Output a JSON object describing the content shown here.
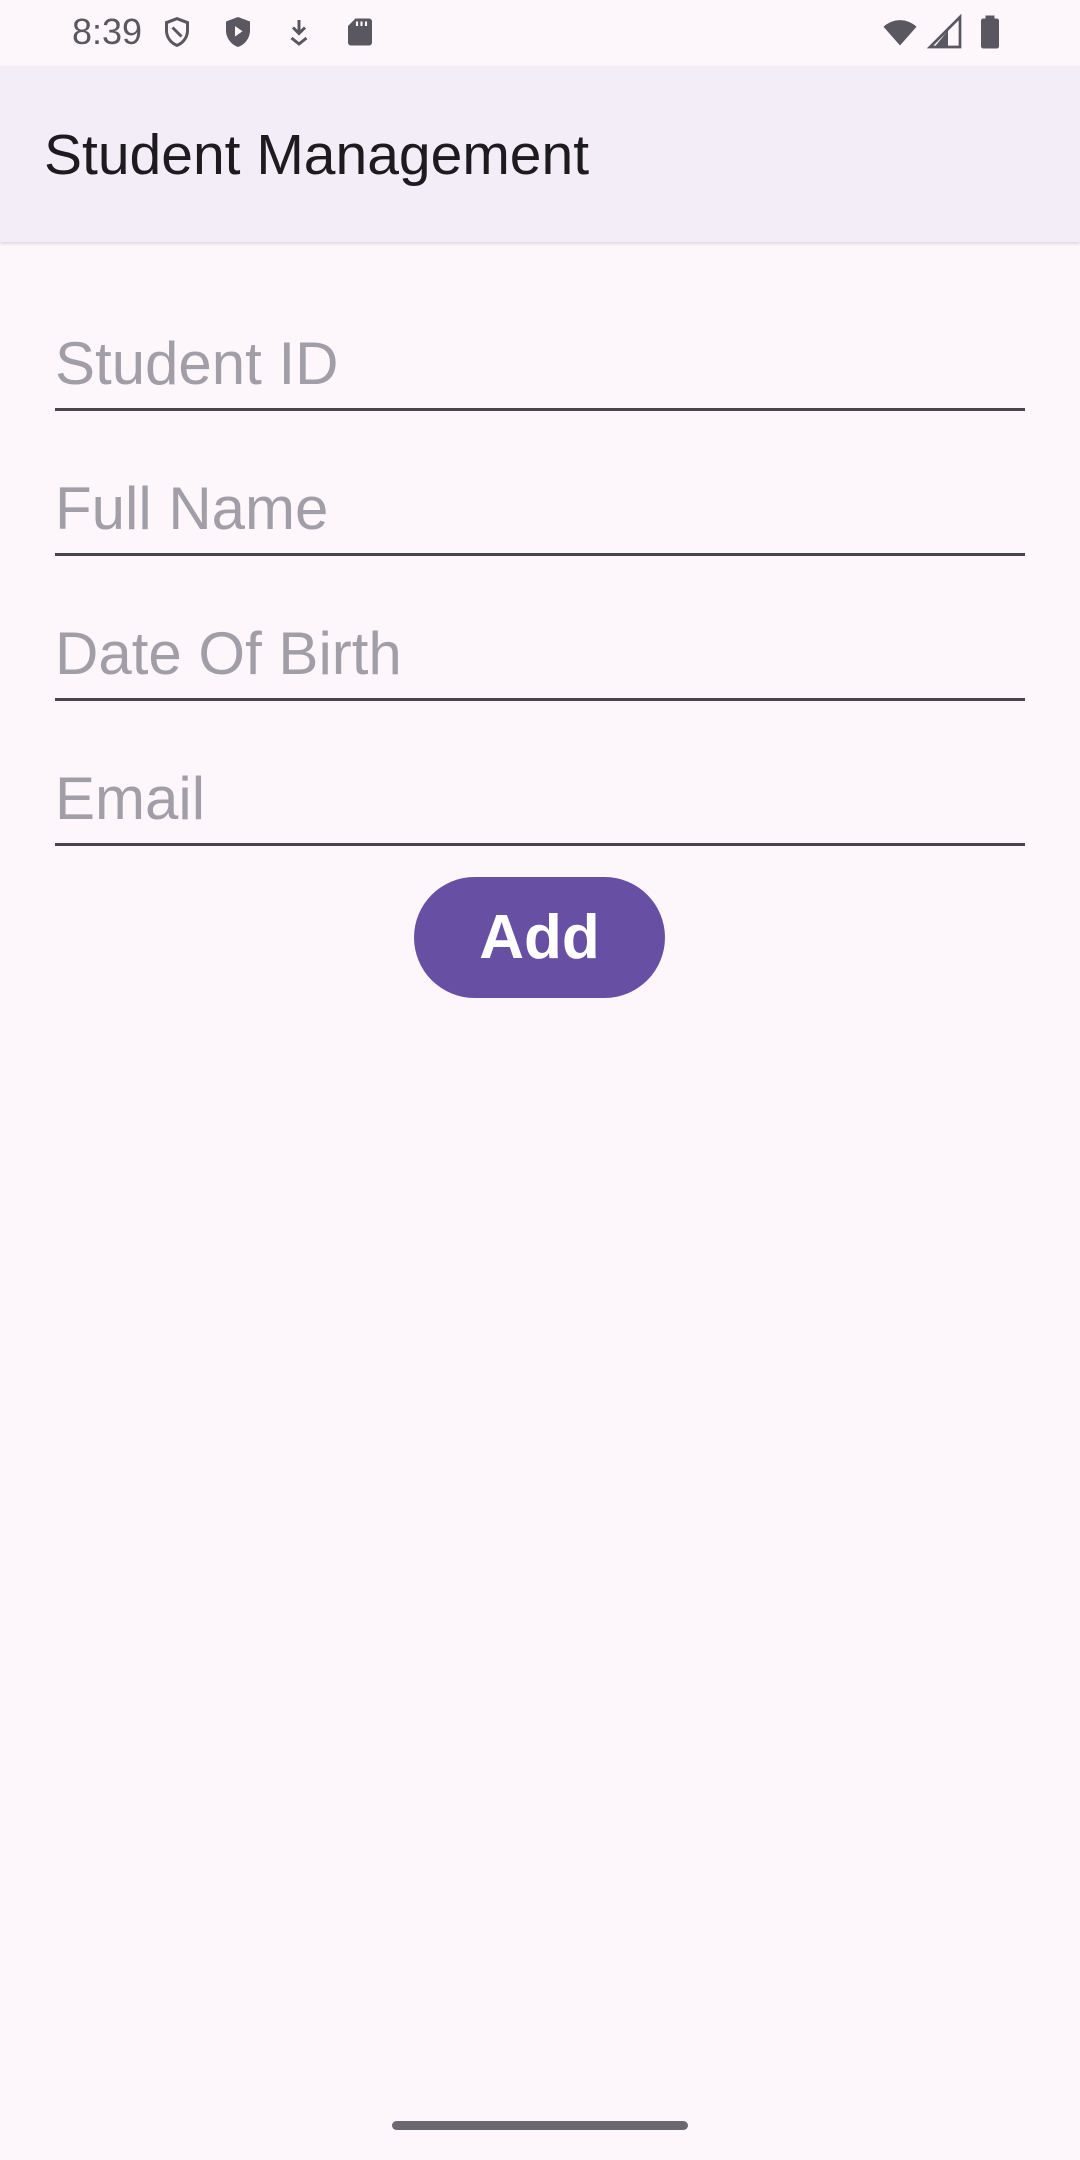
{
  "status_bar": {
    "time": "8:39",
    "left_icons": [
      "shield-outline-icon",
      "shield-play-icon",
      "download-icon",
      "sd-card-icon"
    ],
    "right_icons": [
      "wifi-icon",
      "cell-signal-icon",
      "battery-icon"
    ]
  },
  "app_bar": {
    "title": "Student Management"
  },
  "form": {
    "student_id_placeholder": "Student ID",
    "full_name_placeholder": "Full Name",
    "dob_placeholder": "Date Of Birth",
    "email_placeholder": "Email",
    "add_label": "Add"
  },
  "colors": {
    "background": "#fdf7fc",
    "app_bar": "#f2edf6",
    "accent": "#6750a4"
  }
}
